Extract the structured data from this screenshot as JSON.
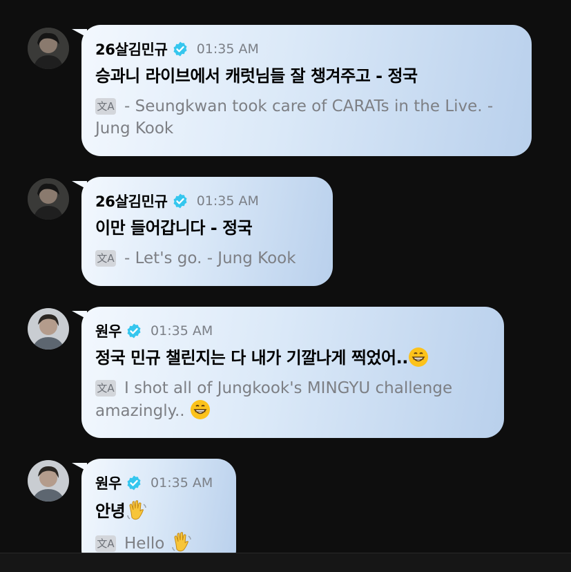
{
  "messages": [
    {
      "name": "26살김민규",
      "time": "01:35 AM",
      "korean": "승과니 라이브에서 캐럿님들 잘 챙겨주고 - 정국",
      "translation": "- Seungkwan took care of CARATs in the Live. - Jung Kook",
      "avatar": "avatar-mingyu"
    },
    {
      "name": "26살김민규",
      "time": "01:35 AM",
      "korean": "이만 들어갑니다 - 정국",
      "translation": "- Let's go. - Jung Kook",
      "avatar": "avatar-mingyu"
    },
    {
      "name": "원우",
      "time": "01:35 AM",
      "korean": "정국 민규 챌린지는 다 내가 기깔나게 찍었어..",
      "korean_emoji": "grinning-face-icon",
      "translation": "I shot all of Jungkook's MINGYU challenge amazingly..",
      "translation_emoji": "grinning-face-icon",
      "avatar": "avatar-wonwoo"
    },
    {
      "name": "원우",
      "time": "01:35 AM",
      "korean": "안녕",
      "korean_emoji": "waving-hand-icon",
      "translation": "Hello",
      "translation_emoji": "waving-hand-icon",
      "avatar": "avatar-wonwoo"
    }
  ],
  "translate_icon": "文A",
  "colors": {
    "background": "#0e0e0e",
    "bubble_light": "#f3f8fe",
    "bubble_dark": "#b9d0ec",
    "verified": "#35c6ee",
    "time": "#7b7f86",
    "translation": "#7d7f84"
  }
}
